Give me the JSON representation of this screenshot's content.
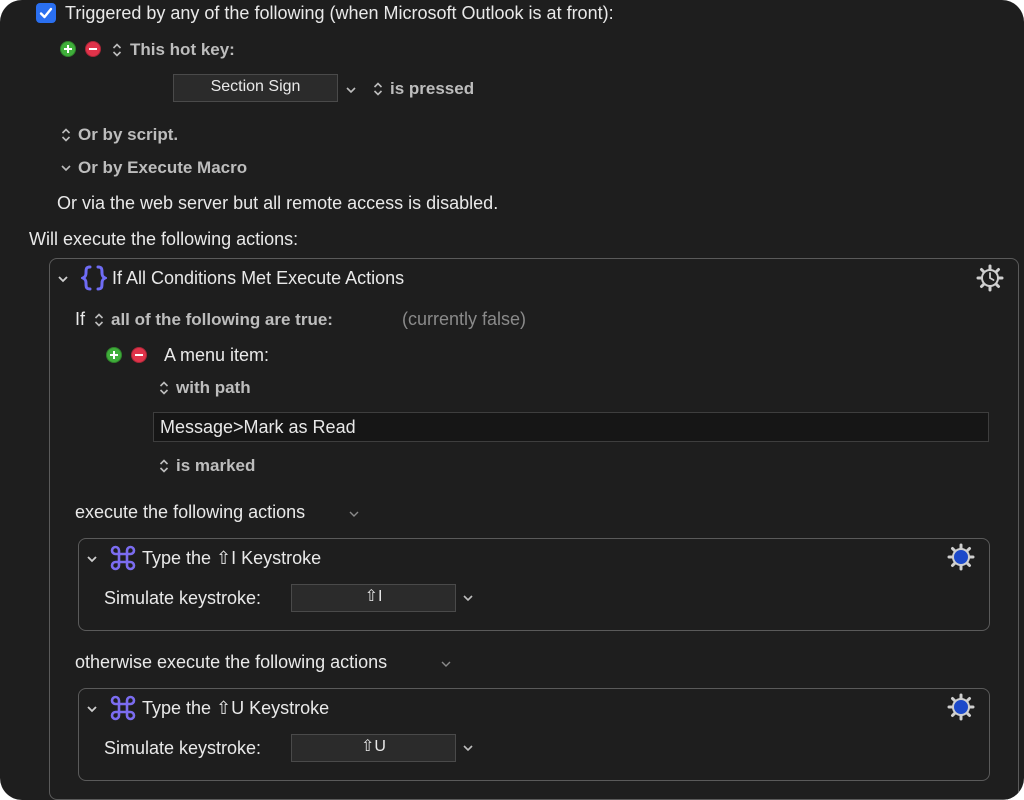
{
  "trigger": {
    "checkbox_checked": true,
    "title": "Triggered by any of the following (when Microsoft Outlook is at front):",
    "hotkey_label": "This hot key:",
    "hotkey_value": "Section Sign",
    "hotkey_state": "is pressed",
    "by_script": "Or by script.",
    "by_execute_macro": "Or by Execute Macro",
    "web_server": "Or via the web server but all remote access is disabled."
  },
  "actions_header": "Will execute the following actions:",
  "if_block": {
    "title": "If All Conditions Met Execute Actions",
    "if_label": "If",
    "condition_mode": "all of the following are true:",
    "current_state": "(currently false)",
    "condition_type": "A menu item:",
    "with_path": "with path",
    "path_value": "Message>Mark as Read",
    "is_marked": "is marked",
    "then_label": "execute the following actions",
    "else_label": "otherwise execute the following actions"
  },
  "then_action": {
    "title": "Type the ⇧I Keystroke",
    "simulate_label": "Simulate keystroke:",
    "keystroke": "⇧I"
  },
  "else_action": {
    "title": "Type the ⇧U Keystroke",
    "simulate_label": "Simulate keystroke:",
    "keystroke": "⇧U"
  },
  "icons": {
    "checkbox": "checkbox-checked",
    "add": "plus-circle-icon",
    "remove": "minus-circle-icon",
    "stepper": "up-down-chevron-icon",
    "disclosure": "chevron-down-icon",
    "if_icon": "braces-icon",
    "gear": "gear-icon",
    "command": "command-icon"
  },
  "colors": {
    "background": "#1e1e1e",
    "accent_blue": "#2a6ff0",
    "plus_green": "#3fae3a",
    "minus_red": "#e0334a",
    "action_purple": "#7b6cf0",
    "gear_blue": "#1c49c9"
  }
}
